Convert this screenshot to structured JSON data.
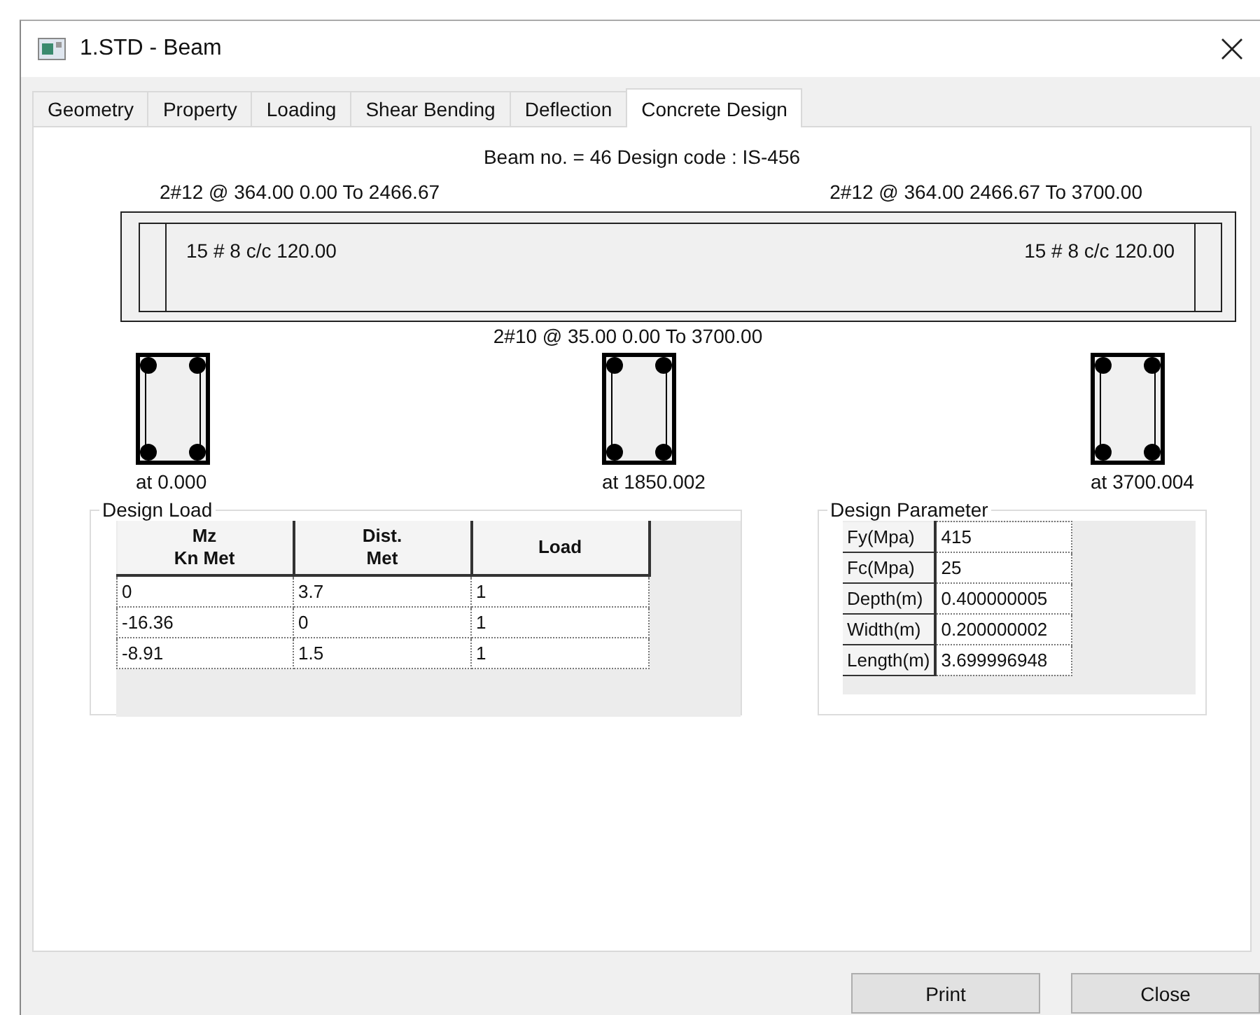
{
  "window": {
    "title": "1.STD - Beam"
  },
  "tabs": [
    {
      "label": "Geometry",
      "selected": false
    },
    {
      "label": "Property",
      "selected": false
    },
    {
      "label": "Loading",
      "selected": false
    },
    {
      "label": "Shear Bending",
      "selected": false
    },
    {
      "label": "Deflection",
      "selected": false
    },
    {
      "label": "Concrete Design",
      "selected": true
    }
  ],
  "header": "Beam no. = 46  Design code :  IS-456",
  "beam": {
    "top_bars": [
      "2#12 @ 364.00 0.00 To 2466.67",
      "2#12 @ 364.00 2466.67 To 3700.00"
    ],
    "stirrups": [
      "15 # 8 c/c 120.00",
      "15 # 8 c/c 120.00"
    ],
    "bottom_bars": "2#10 @ 35.00 0.00 To 3700.00"
  },
  "sections": [
    {
      "label": "at 0.000"
    },
    {
      "label": "at 1850.002"
    },
    {
      "label": "at 3700.004"
    }
  ],
  "design_load": {
    "title": "Design Load",
    "columns": [
      "Mz\nKn Met",
      "Dist.\nMet",
      "Load"
    ],
    "rows": [
      [
        "0",
        "3.7",
        "1"
      ],
      [
        "-16.36",
        "0",
        "1"
      ],
      [
        "-8.91",
        "1.5",
        "1"
      ]
    ]
  },
  "design_parameter": {
    "title": "Design Parameter",
    "rows": [
      [
        "Fy(Mpa)",
        "415"
      ],
      [
        "Fc(Mpa)",
        "25"
      ],
      [
        "Depth(m)",
        "0.400000005"
      ],
      [
        "Width(m)",
        "0.200000002"
      ],
      [
        "Length(m)",
        "3.699996948"
      ]
    ]
  },
  "buttons": [
    "Print",
    "Close"
  ]
}
